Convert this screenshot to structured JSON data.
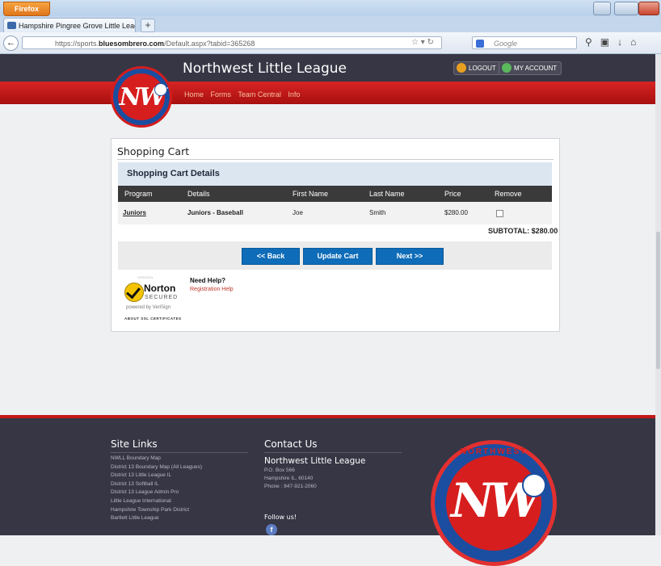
{
  "browser": {
    "app_button": "Firefox",
    "tab_title": "Hampshire Pingree Grove Little League ...",
    "url_prefix": "https://sports.",
    "url_domain": "bluesombrero.com",
    "url_path": "/Default.aspx?tabid=365268",
    "search_engine": "Google"
  },
  "header": {
    "site_title": "Northwest Little League",
    "logout_label": "LOGOUT",
    "account_label": "MY ACCOUNT",
    "nav": [
      "Home",
      "Forms",
      "Team Central",
      "Info"
    ],
    "logo_text": "NW"
  },
  "cart": {
    "title": "Shopping Cart",
    "details_heading": "Shopping Cart Details",
    "columns": [
      "Program",
      "Details",
      "First Name",
      "Last Name",
      "Price",
      "Remove"
    ],
    "rows": [
      {
        "program": "Juniors",
        "details": "Juniors - Baseball",
        "first_name": "Joe",
        "last_name": "Smith",
        "price": "$280.00"
      }
    ],
    "subtotal": "SUBTOTAL: $280.00",
    "buttons": {
      "back": "<< Back",
      "update": "Update Cart",
      "next": "Next >>"
    },
    "help_heading": "Need Help?",
    "help_link": "Registration Help",
    "norton": {
      "name": "Norton",
      "secured": "SECURED",
      "powered": "powered by VeriSign",
      "about": "ABOUT SSL CERTIFICATES"
    }
  },
  "footer": {
    "site_links_heading": "Site Links",
    "site_links": [
      "NWLL Boundary Map",
      "District 13 Boundary Map (All Leagues)",
      "District 13 Little League IL",
      "District 13 Softball IL",
      "District 13 League Admin Pro",
      "Little League International",
      "Hampshire Township Park District",
      "Bartlett Little League"
    ],
    "contact_heading": "Contact Us",
    "org_name": "Northwest Little League",
    "contact_lines": [
      "P.O. Box 566",
      "Hampshire IL, 60140",
      "Phone : 847-921-2060"
    ],
    "follow": "Follow us!",
    "logo_ring": "NORTHWEST",
    "logo_text": "NW"
  },
  "colors": {
    "header_bg": "#363645",
    "red_bar": "#c41717",
    "button_blue": "#0e6cb8",
    "details_bg": "#dce6f0"
  }
}
